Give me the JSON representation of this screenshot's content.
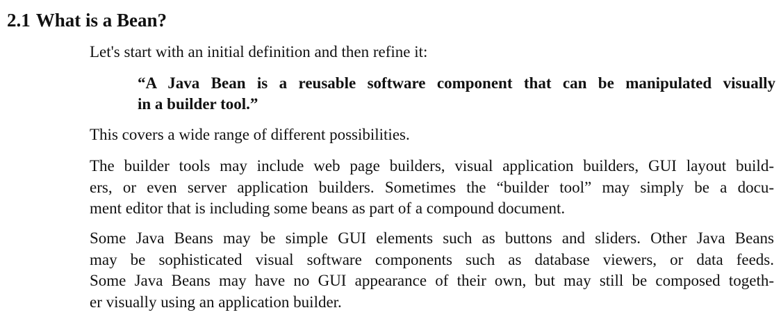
{
  "section": {
    "number": "2.1",
    "title": "What is a Bean?"
  },
  "paragraphs": {
    "intro": "Let's start with an initial definition and then refine it:",
    "quote_lines": [
      "“A Java Bean is a reusable software component that can be manipulated visually",
      "in a builder tool.”"
    ],
    "range": "This covers a wide range of different possibilities.",
    "tools_lines": [
      "The builder tools may include web page builders, visual application builders, GUI layout build-",
      "ers, or even server application builders. Sometimes the “builder tool” may simply be a docu-",
      "ment editor that is including some beans as part of a compound document."
    ],
    "beans_lines": [
      "Some Java Beans may be simple GUI elements such as buttons and sliders. Other Java Beans",
      "may be sophisticated visual software components such as database viewers, or data feeds.",
      "Some Java Beans may have no GUI appearance of their own, but may still be composed togeth-",
      "er visually using an application builder."
    ]
  }
}
